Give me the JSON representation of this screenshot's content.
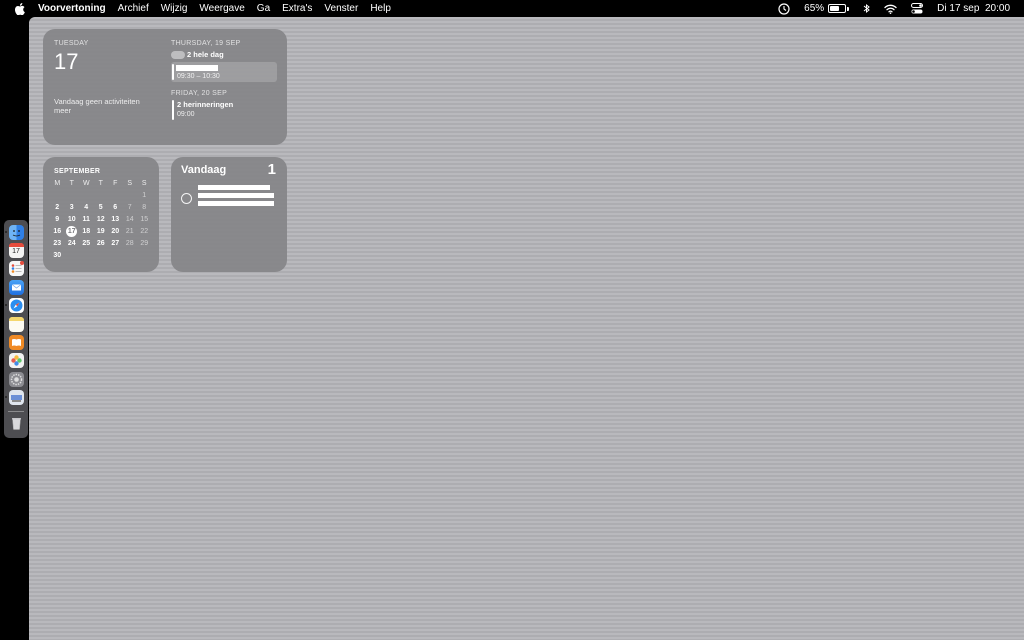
{
  "menubar": {
    "app_name": "Voorvertoning",
    "items": [
      "Archief",
      "Wijzig",
      "Weergave",
      "Ga",
      "Extra's",
      "Venster",
      "Help"
    ],
    "battery_percent": "65%",
    "battery_level": 0.65,
    "datetime": "Di 17 sep  20:00"
  },
  "upnext": {
    "weekday": "TUESDAY",
    "day": "17",
    "no_events": "Vandaag geen activiteiten meer",
    "section1_head": "THURSDAY, 19 SEP",
    "allday_label": "2 hele dag",
    "event_time": "09:30 – 10:30",
    "section2_head": "FRIDAY, 20 SEP",
    "reminders_label": "2 herinneringen",
    "reminders_time": "09:00"
  },
  "month": {
    "title": "SEPTEMBER",
    "weekdays": [
      "M",
      "T",
      "W",
      "T",
      "F",
      "S",
      "S"
    ],
    "leading_blanks": 6,
    "days_in_month": 30,
    "today": 17
  },
  "reminders": {
    "title": "Vandaag",
    "count": "1"
  },
  "dock": {
    "icons": [
      "finder-icon",
      "calendar-icon",
      "reminders-icon",
      "mail-icon",
      "safari-icon",
      "notes-icon",
      "books-icon",
      "photos-icon",
      "system-settings-icon",
      "preview-icon"
    ],
    "colors": {
      "finder": "#3b8ee8",
      "calendar": "#f4f4f4",
      "reminders": "#f7f7f7",
      "mail": "#2f7fe6",
      "safari": "#2c8ef0",
      "notes": "#f5d76e",
      "books": "#f08a24",
      "photos": "#e9e9e9",
      "settings": "#8d8d92",
      "preview": "#6b8fd6"
    }
  }
}
